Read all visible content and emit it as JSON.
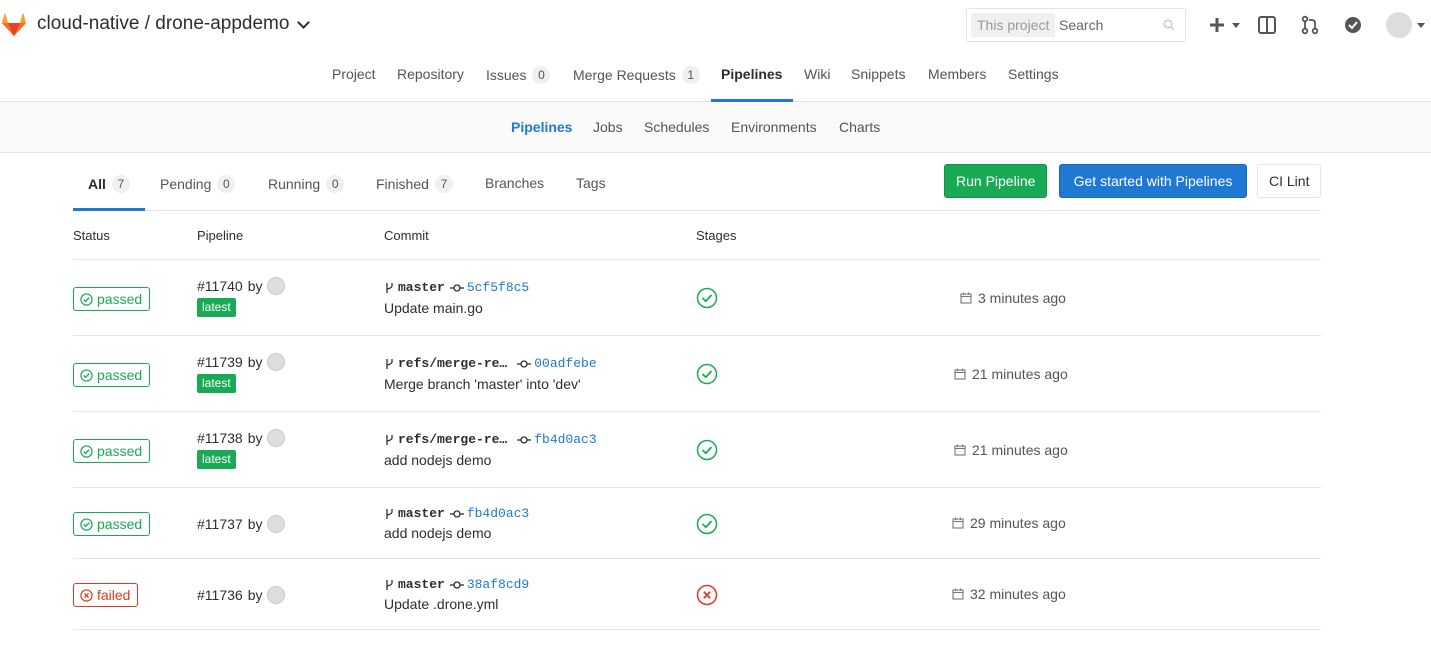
{
  "header": {
    "title": "cloud-native / drone-appdemo",
    "search_scope": "This project",
    "search_placeholder": "Search"
  },
  "colors": {
    "accent": "#1f78d1",
    "success": "#1aaa55",
    "danger": "#db3b21"
  },
  "project_nav": [
    {
      "label": "Project"
    },
    {
      "label": "Repository"
    },
    {
      "label": "Issues",
      "count": "0"
    },
    {
      "label": "Merge Requests",
      "count": "1"
    },
    {
      "label": "Pipelines",
      "active": true
    },
    {
      "label": "Wiki"
    },
    {
      "label": "Snippets"
    },
    {
      "label": "Members"
    },
    {
      "label": "Settings"
    }
  ],
  "sub_nav": [
    {
      "label": "Pipelines",
      "active": true
    },
    {
      "label": "Jobs"
    },
    {
      "label": "Schedules"
    },
    {
      "label": "Environments"
    },
    {
      "label": "Charts"
    }
  ],
  "scope_tabs": [
    {
      "label": "All",
      "count": "7",
      "active": true
    },
    {
      "label": "Pending",
      "count": "0"
    },
    {
      "label": "Running",
      "count": "0"
    },
    {
      "label": "Finished",
      "count": "7"
    },
    {
      "label": "Branches"
    },
    {
      "label": "Tags"
    }
  ],
  "actions": {
    "run_pipeline": "Run Pipeline",
    "get_started": "Get started with Pipelines",
    "ci_lint": "CI Lint"
  },
  "table": {
    "headers": {
      "status": "Status",
      "pipeline": "Pipeline",
      "commit": "Commit",
      "stages": "Stages"
    },
    "rows": [
      {
        "status": "passed",
        "id": "#11740",
        "by": "by",
        "latest": "latest",
        "ref": "master",
        "sha": "5cf5f8c5",
        "message": "Update main.go",
        "stage": "success",
        "time": "3 minutes ago"
      },
      {
        "status": "passed",
        "id": "#11739",
        "by": "by",
        "latest": "latest",
        "ref": "refs/merge-re…",
        "sha": "00adfebe",
        "message": "Merge branch 'master' into 'dev'",
        "stage": "success",
        "time": "21 minutes ago"
      },
      {
        "status": "passed",
        "id": "#11738",
        "by": "by",
        "latest": "latest",
        "ref": "refs/merge-re…",
        "sha": "fb4d0ac3",
        "message": "add nodejs demo",
        "stage": "success",
        "time": "21 minutes ago"
      },
      {
        "status": "passed",
        "id": "#11737",
        "by": "by",
        "ref": "master",
        "sha": "fb4d0ac3",
        "message": "add nodejs demo",
        "stage": "success",
        "time": "29 minutes ago"
      },
      {
        "status": "failed",
        "id": "#11736",
        "by": "by",
        "ref": "master",
        "sha": "38af8cd9",
        "message": "Update .drone.yml",
        "stage": "failed",
        "time": "32 minutes ago"
      }
    ]
  }
}
